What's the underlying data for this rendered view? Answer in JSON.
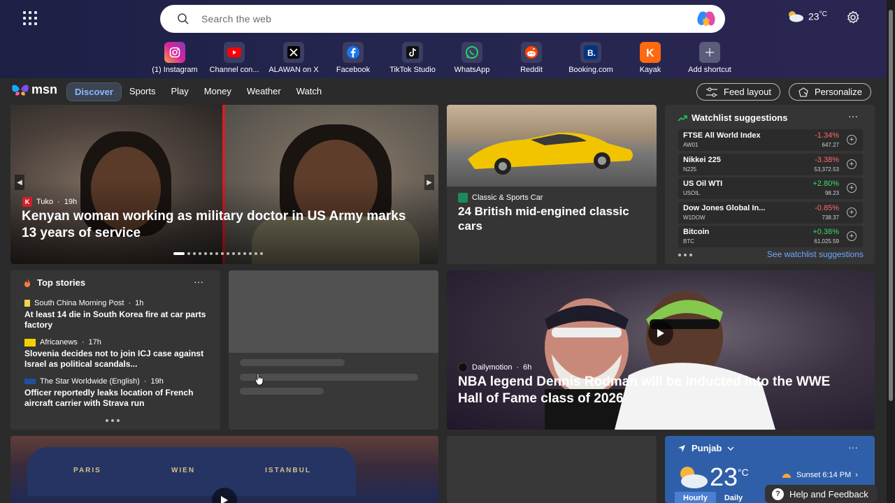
{
  "search": {
    "placeholder": "Search the web"
  },
  "top_weather": {
    "temp": "23",
    "unit": "°C"
  },
  "shortcuts": [
    {
      "label": "(1) Instagram",
      "icon": "instagram-icon",
      "color": "#d6249f"
    },
    {
      "label": "Channel con...",
      "icon": "youtube-icon",
      "color": "#ff0000"
    },
    {
      "label": "ALAWAN on X",
      "icon": "x-icon",
      "color": "#000000"
    },
    {
      "label": "Facebook",
      "icon": "facebook-icon",
      "color": "#1877f2"
    },
    {
      "label": "TikTok Studio",
      "icon": "tiktok-icon",
      "color": "#111111"
    },
    {
      "label": "WhatsApp",
      "icon": "whatsapp-icon",
      "color": "#25d366"
    },
    {
      "label": "Reddit",
      "icon": "reddit-icon",
      "color": "#ff4500"
    },
    {
      "label": "Booking.com",
      "icon": "booking-icon",
      "color": "#003580"
    },
    {
      "label": "Kayak",
      "icon": "kayak-icon",
      "color": "#ff690f"
    },
    {
      "label": "Add shortcut",
      "icon": "plus-icon",
      "color": "#5a5c7a"
    }
  ],
  "brand": {
    "name": "msn"
  },
  "nav": [
    "Discover",
    "Sports",
    "Play",
    "Money",
    "Weather",
    "Watch"
  ],
  "buttons": {
    "feed_layout": "Feed layout",
    "personalize": "Personalize"
  },
  "hero": {
    "source": "Tuko",
    "time": "19h",
    "headline": "Kenyan woman working as military doctor in US Army marks 13 years of service"
  },
  "car": {
    "source": "Classic & Sports Car",
    "headline": "24 British mid-engined classic cars"
  },
  "watchlist": {
    "title": "Watchlist suggestions",
    "more": "···",
    "items": [
      {
        "name": "FTSE All World Index",
        "symbol": "AW01",
        "change": "-1.34%",
        "price": "647.27",
        "up": false
      },
      {
        "name": "Nikkei 225",
        "symbol": "N225",
        "change": "-3.38%",
        "price": "53,372.53",
        "up": false
      },
      {
        "name": "US Oil WTI",
        "symbol": "USOIL",
        "change": "+2.80%",
        "price": "98.23",
        "up": true
      },
      {
        "name": "Dow Jones Global In...",
        "symbol": "W1DOW",
        "change": "-0.85%",
        "price": "738.37",
        "up": false
      },
      {
        "name": "Bitcoin",
        "symbol": "BTC",
        "change": "+0.36%",
        "price": "61,025.59",
        "up": true
      }
    ],
    "see_all": "See watchlist suggestions"
  },
  "top_stories": {
    "title": "Top stories",
    "more": "···",
    "stories": [
      {
        "source": "South China Morning Post",
        "time": "1h",
        "title": "At least 14 die in South Korea fire at car parts factory"
      },
      {
        "source": "Africanews",
        "time": "17h",
        "title": "Slovenia decides not to join ICJ case against Israel as political scandals..."
      },
      {
        "source": "The Star Worldwide (English)",
        "time": "19h",
        "title": "Officer reportedly leaks location of French aircraft carrier with Strava run"
      }
    ]
  },
  "video": {
    "source": "Dailymotion",
    "time": "6h",
    "headline": "NBA legend Dennis Rodman will be inducted into the WWE Hall of Fame class of 2026"
  },
  "train": {
    "signs": [
      "PARIS",
      "WIEN",
      "ISTANBUL"
    ]
  },
  "weather_card": {
    "location": "Punjab",
    "temp": "23",
    "unit": "°C",
    "sunset": "Sunset 6:14 PM",
    "tabs": [
      "Hourly",
      "Daily"
    ],
    "more": "···"
  },
  "help": {
    "label": "Help and Feedback"
  }
}
